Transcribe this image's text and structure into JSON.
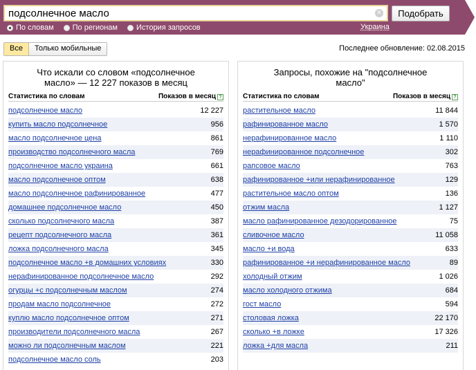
{
  "search": {
    "query": "подсолнечное масло",
    "button_label": "Подобрать",
    "clear_glyph": "✕"
  },
  "modes": [
    {
      "label": "По словам",
      "selected": true
    },
    {
      "label": "По регионам",
      "selected": false
    },
    {
      "label": "История запросов",
      "selected": false
    }
  ],
  "region": "Украина",
  "filters": [
    {
      "label": "Все",
      "active": true
    },
    {
      "label": "Только мобильные",
      "active": false
    }
  ],
  "last_update": "Последнее обновление: 02.08.2015",
  "colors": {
    "band": "#8e4a6c",
    "link": "#1d3fa6",
    "active_filter": "#fde9a1",
    "row_alt": "#eef1f7"
  },
  "left_panel": {
    "title": "Что искали со словом «подсолнечное масло» — 12 227 показов в месяц",
    "col_left": "Статистика по словам",
    "col_right": "Показов в месяц",
    "help_glyph": "?",
    "rows": [
      {
        "phrase": "подсолнечное масло",
        "count": "12 227"
      },
      {
        "phrase": "купить масло подсолнечное",
        "count": "956"
      },
      {
        "phrase": "масло подсолнечное цена",
        "count": "861"
      },
      {
        "phrase": "производство подсолнечного масла",
        "count": "769"
      },
      {
        "phrase": "подсолнечное масло украина",
        "count": "661"
      },
      {
        "phrase": "масло подсолнечное оптом",
        "count": "638"
      },
      {
        "phrase": "масло подсолнечное рафинированное",
        "count": "477"
      },
      {
        "phrase": "домашнее подсолнечное масло",
        "count": "450"
      },
      {
        "phrase": "сколько подсолнечного масла",
        "count": "387"
      },
      {
        "phrase": "рецепт подсолнечного масла",
        "count": "361"
      },
      {
        "phrase": "ложка подсолнечного масла",
        "count": "345"
      },
      {
        "phrase": "подсолнечное масло +в домашних условиях",
        "count": "330"
      },
      {
        "phrase": "нерафинированное подсолнечное масло",
        "count": "292"
      },
      {
        "phrase": "огурцы +с подсолнечным маслом",
        "count": "274"
      },
      {
        "phrase": "продам масло подсолнечное",
        "count": "272"
      },
      {
        "phrase": "куплю масло подсолнечное оптом",
        "count": "271"
      },
      {
        "phrase": "производители подсолнечного масла",
        "count": "267"
      },
      {
        "phrase": "можно ли подсолнечным маслом",
        "count": "221"
      },
      {
        "phrase": "подсолнечное масло соль",
        "count": "203"
      }
    ]
  },
  "right_panel": {
    "title": "Запросы, похожие на \"подсолнечное масло\"",
    "col_left": "Статистика по словам",
    "col_right": "Показов в месяц",
    "help_glyph": "?",
    "rows": [
      {
        "phrase": "растительное масло",
        "count": "11 844"
      },
      {
        "phrase": "рафинированное масло",
        "count": "1 570"
      },
      {
        "phrase": "нерафинированное масло",
        "count": "1 110"
      },
      {
        "phrase": "нерафинированное подсолнечное",
        "count": "302"
      },
      {
        "phrase": "рапсовое масло",
        "count": "763"
      },
      {
        "phrase": "рафинированное +или нерафинированное",
        "count": "129"
      },
      {
        "phrase": "растительное масло оптом",
        "count": "136"
      },
      {
        "phrase": "отжим масла",
        "count": "1 127"
      },
      {
        "phrase": "масло рафинированное дезодорированное",
        "count": "75"
      },
      {
        "phrase": "сливочное масло",
        "count": "11 058"
      },
      {
        "phrase": "масло +и вода",
        "count": "633"
      },
      {
        "phrase": "рафинированное +и нерафинированное масло",
        "count": "89"
      },
      {
        "phrase": "холодный отжим",
        "count": "1 026"
      },
      {
        "phrase": "масло холодного отжима",
        "count": "684"
      },
      {
        "phrase": "гост масло",
        "count": "594"
      },
      {
        "phrase": "столовая ложка",
        "count": "22 170"
      },
      {
        "phrase": "сколько +в ложке",
        "count": "17 326"
      },
      {
        "phrase": "ложка +для масла",
        "count": "211"
      }
    ]
  }
}
